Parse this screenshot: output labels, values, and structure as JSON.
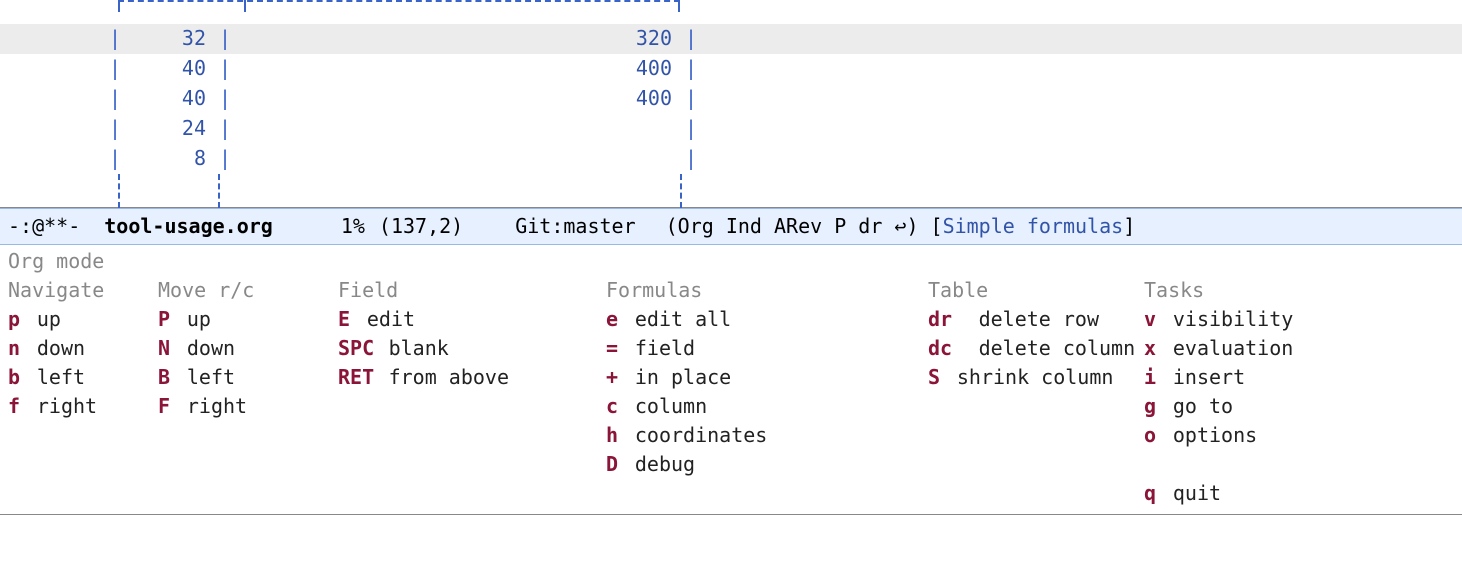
{
  "table": {
    "rows": [
      {
        "c1": "32",
        "c2": "320",
        "highlight": true
      },
      {
        "c1": "40",
        "c2": "400",
        "highlight": false
      },
      {
        "c1": "40",
        "c2": "400",
        "highlight": false
      },
      {
        "c1": "24",
        "c2": "",
        "highlight": false
      },
      {
        "c1": "8",
        "c2": "",
        "highlight": false
      }
    ]
  },
  "modeline": {
    "prefix": "-:@**-",
    "filename": "tool-usage.org",
    "percent": "1%",
    "position": "(137,2)",
    "vcs": "Git:master",
    "modes_open": "(Org Ind ARev P dr ",
    "return_glyph": "↩",
    "modes_close": ")",
    "bracket_open": "[",
    "context": "Simple formulas",
    "bracket_close": "]"
  },
  "help": {
    "title": "Org mode",
    "columns": [
      {
        "id": "navigate",
        "head": "Navigate",
        "items": [
          {
            "key": "p",
            "desc": "up"
          },
          {
            "key": "n",
            "desc": "down"
          },
          {
            "key": "b",
            "desc": "left"
          },
          {
            "key": "f",
            "desc": "right"
          }
        ]
      },
      {
        "id": "move",
        "head": "Move r/c",
        "items": [
          {
            "key": "P",
            "desc": "up"
          },
          {
            "key": "N",
            "desc": "down"
          },
          {
            "key": "B",
            "desc": "left"
          },
          {
            "key": "F",
            "desc": "right"
          }
        ]
      },
      {
        "id": "field",
        "head": "Field",
        "items": [
          {
            "key": "E",
            "desc": "edit"
          },
          {
            "key": "SPC",
            "desc": "blank"
          },
          {
            "key": "RET",
            "desc": "from above"
          }
        ]
      },
      {
        "id": "formulas",
        "head": "Formulas",
        "items": [
          {
            "key": "e",
            "desc": "edit all"
          },
          {
            "key": "=",
            "desc": "field"
          },
          {
            "key": "+",
            "desc": "in place"
          },
          {
            "key": "c",
            "desc": "column"
          },
          {
            "key": "h",
            "desc": "coordinates"
          },
          {
            "key": "D",
            "desc": "debug"
          }
        ]
      },
      {
        "id": "table",
        "head": "Table",
        "items": [
          {
            "key": "dr",
            "desc": "delete row"
          },
          {
            "key": "dc",
            "desc": "delete column"
          },
          {
            "key": "S",
            "desc": "shrink column"
          }
        ]
      },
      {
        "id": "tasks",
        "head": "Tasks",
        "items": [
          {
            "key": "v",
            "desc": "visibility"
          },
          {
            "key": "x",
            "desc": "evaluation"
          },
          {
            "key": "i",
            "desc": "insert"
          },
          {
            "key": "g",
            "desc": "go to"
          },
          {
            "key": "o",
            "desc": "options"
          }
        ],
        "trailing": [
          {
            "key": "q",
            "desc": "quit"
          }
        ]
      }
    ]
  }
}
